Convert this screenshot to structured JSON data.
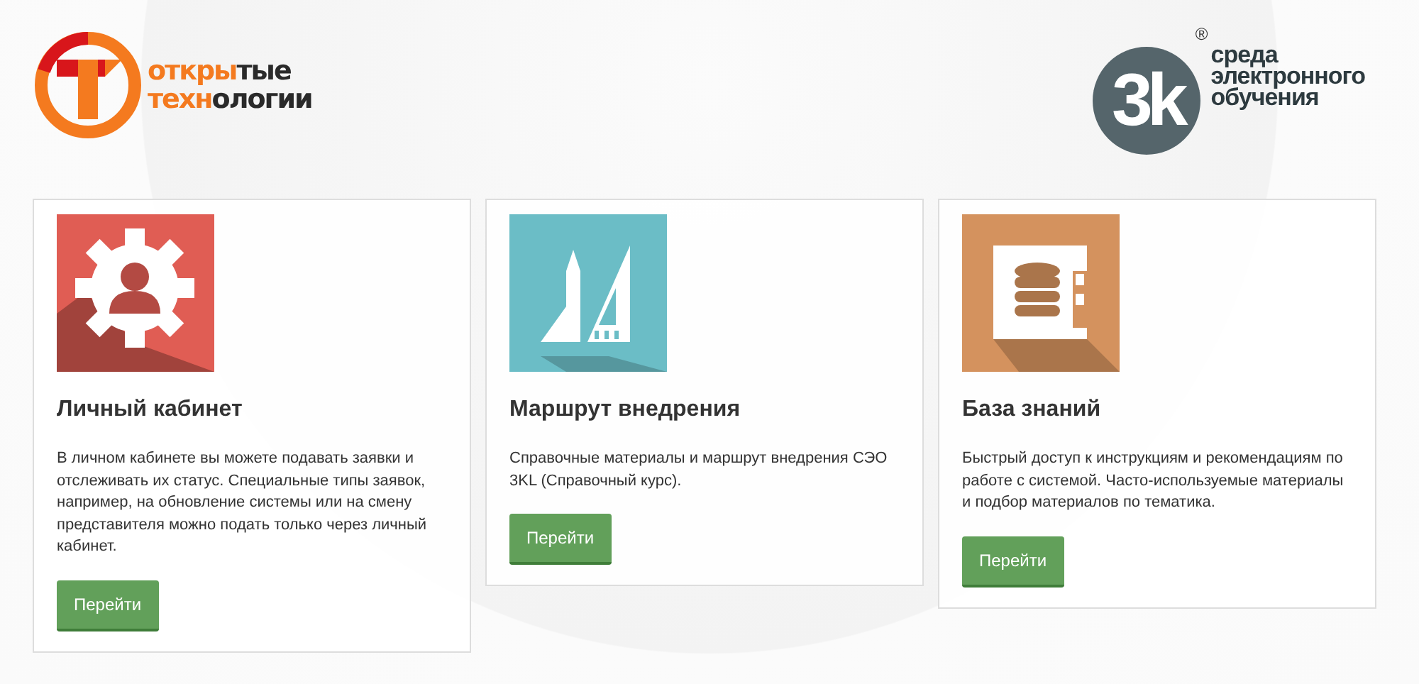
{
  "header": {
    "logo_left": {
      "lines": [
        [
          {
            "text": "откры",
            "accent": true
          },
          {
            "text": "тые",
            "accent": false
          }
        ],
        [
          {
            "text": "техн",
            "accent": true
          },
          {
            "text": "ологии",
            "accent": false
          }
        ]
      ]
    },
    "logo_right": {
      "mark": "3k",
      "registered": "®",
      "lines": [
        "среда",
        "электронного",
        "обучения"
      ]
    }
  },
  "cards": [
    {
      "kind": "cabinet",
      "color": "#e05d54",
      "title": "Личный кабинет",
      "text": "В личном кабинете вы можете подавать заявки и отслеживать их статус. Специальные типы заявок, например, на обновление системы или на смену представителя можно подать только через личный кабинет.",
      "button": "Перейти"
    },
    {
      "kind": "route",
      "color": "#6bbdc6",
      "title": "Маршрут внедрения",
      "text": "Справочные материалы и маршрут внедрения СЭО 3KL (Справочный курс).",
      "button": "Перейти"
    },
    {
      "kind": "knowledge",
      "color": "#d4925e",
      "title": "База знаний",
      "text": "Быстрый доступ к инструкциям и рекомендациям по работе с системой. Часто-используемые материалы и подбор материалов по тематика.",
      "button": "Перейти"
    }
  ]
}
